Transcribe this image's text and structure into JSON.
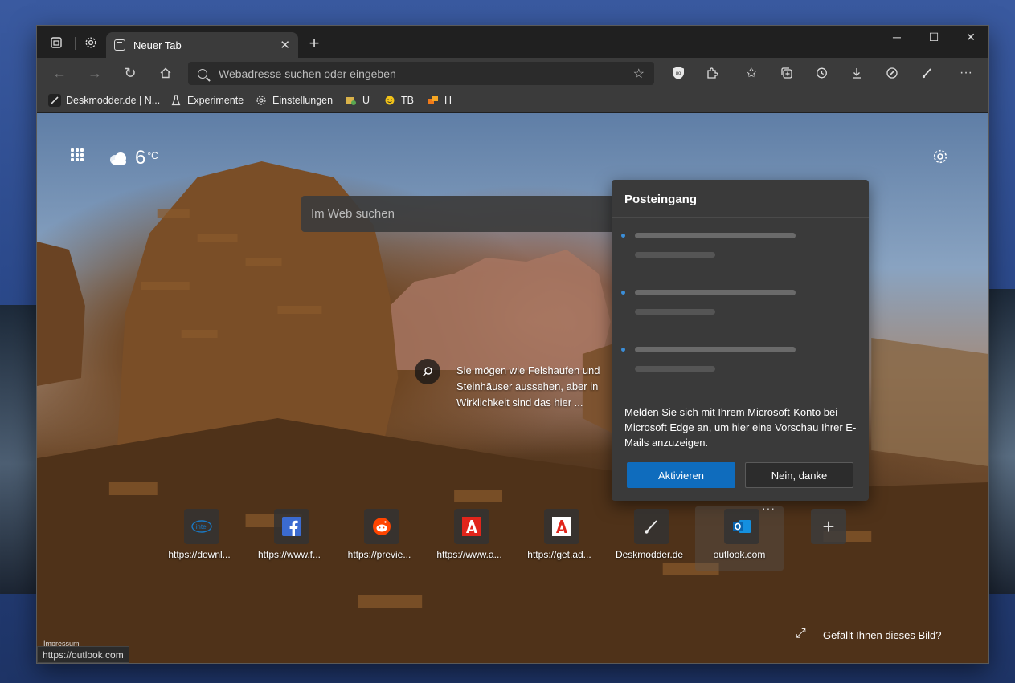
{
  "tab": {
    "title": "Neuer Tab",
    "close": "✕"
  },
  "titlebar": {
    "new_tab": "+",
    "minimize": "─",
    "maximize": "☐",
    "close": "✕"
  },
  "address": {
    "placeholder": "Webadresse suchen oder eingeben"
  },
  "bookmarks": [
    {
      "label": "Deskmodder.de | N...",
      "icon": "brush-icon"
    },
    {
      "label": "Experimente",
      "icon": "flask-icon"
    },
    {
      "label": "Einstellungen",
      "icon": "gear-icon"
    },
    {
      "label": "U",
      "icon": "folder-u-icon"
    },
    {
      "label": "TB",
      "icon": "smiley-icon"
    },
    {
      "label": "H",
      "icon": "puzzle-h-icon"
    }
  ],
  "weather": {
    "temp": "6",
    "unit": "°C"
  },
  "web_search": {
    "placeholder": "Im Web suchen"
  },
  "image_info": {
    "text": "Sie mögen wie Felshaufen und Steinhäuser aussehen, aber in Wirklichkeit sind das hier ..."
  },
  "inbox": {
    "title": "Posteingang",
    "message": "Melden Sie sich mit Ihrem Microsoft-Konto bei Microsoft Edge an, um hier eine Vorschau Ihrer E-Mails anzuzeigen.",
    "activate": "Aktivieren",
    "decline": "Nein, danke"
  },
  "tiles": [
    {
      "label": "https://downl...",
      "icon": "intel-icon"
    },
    {
      "label": "https://www.f...",
      "icon": "facebook-icon"
    },
    {
      "label": "https://previe...",
      "icon": "reddit-icon"
    },
    {
      "label": "https://www.a...",
      "icon": "adobe-icon"
    },
    {
      "label": "https://get.ad...",
      "icon": "adobe-icon"
    },
    {
      "label": "Deskmodder.de",
      "icon": "brush-icon"
    },
    {
      "label": "outlook.com",
      "icon": "outlook-icon"
    }
  ],
  "footer": {
    "imprint": "Impressum",
    "like": "Gefällt Ihnen dieses Bild?"
  },
  "status_bar": {
    "url": "https://outlook.com"
  },
  "colors": {
    "accent": "#0f6cbd",
    "toolbar": "#3b3b3b",
    "titlebar": "#202020"
  }
}
